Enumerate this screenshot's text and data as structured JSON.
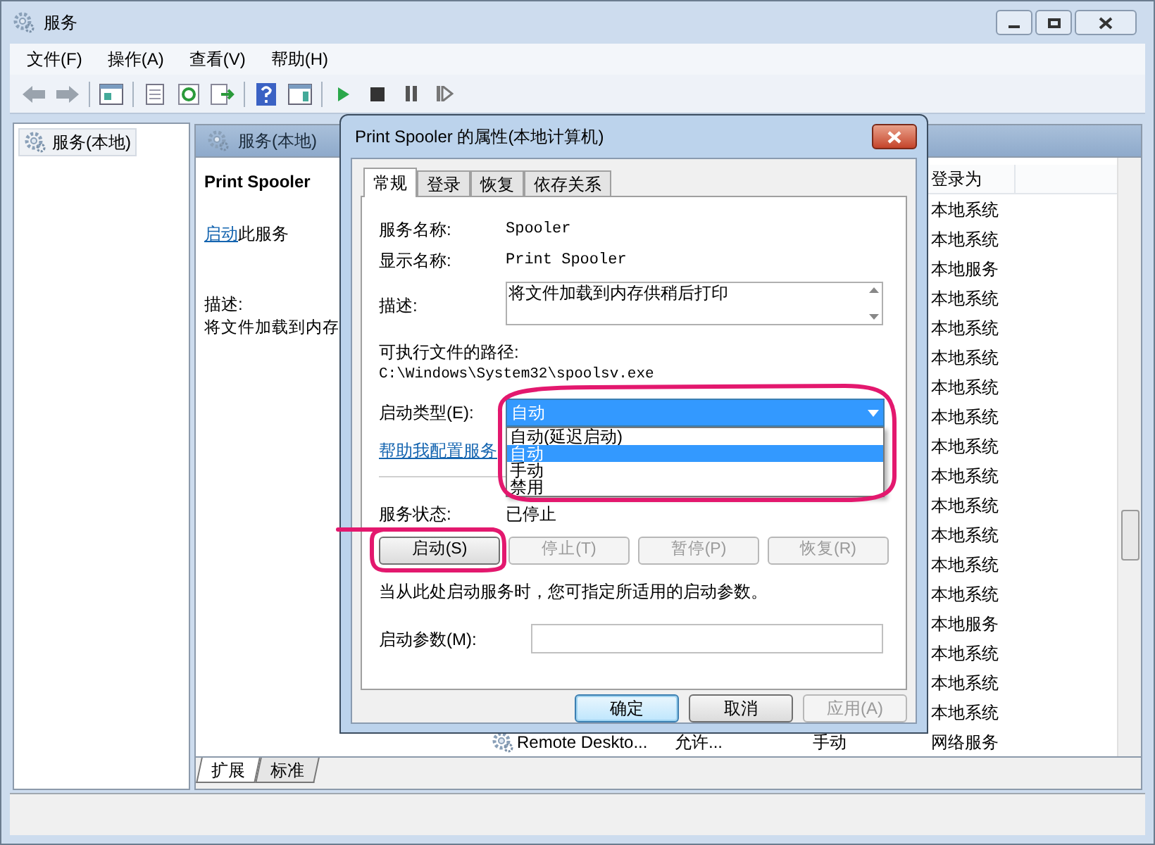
{
  "window": {
    "title": "服务",
    "menu": [
      "文件(F)",
      "操作(A)",
      "查看(V)",
      "帮助(H)"
    ]
  },
  "tree": {
    "items": [
      {
        "label": "服务(本地)",
        "selected": true
      }
    ]
  },
  "pane": {
    "header": "服务(本地)",
    "detail": {
      "service_name": "Print Spooler",
      "action_link": "启动",
      "action_text": "此服务",
      "description_label": "描述:",
      "description": "将文件加载到内存"
    },
    "list": {
      "columns": [
        {
          "label": "登录为"
        }
      ],
      "rows": [
        {
          "logon": "本地系统"
        },
        {
          "logon": "本地系统"
        },
        {
          "logon": "本地服务"
        },
        {
          "logon": "本地系统"
        },
        {
          "logon": "本地系统"
        },
        {
          "logon": "本地系统"
        },
        {
          "logon": "本地系统"
        },
        {
          "logon": "本地系统"
        },
        {
          "logon": "本地系统"
        },
        {
          "logon": "本地系统"
        },
        {
          "logon": "本地系统"
        },
        {
          "logon": "本地系统"
        },
        {
          "logon": "本地系统"
        },
        {
          "logon": "本地系统"
        },
        {
          "logon": "本地服务"
        },
        {
          "logon": "本地系统"
        },
        {
          "logon": "本地系统"
        },
        {
          "logon": "本地系统"
        },
        {
          "name": "Remote Deskto...",
          "description": "允许...",
          "startup": "手动",
          "logon": "网络服务"
        }
      ]
    },
    "bottom_tabs": [
      {
        "label": "扩展",
        "selected": true
      },
      {
        "label": "标准",
        "selected": false
      }
    ]
  },
  "dialog": {
    "title": "Print Spooler 的属性(本地计算机)",
    "tabs": [
      {
        "label": "常规",
        "selected": true
      },
      {
        "label": "登录",
        "selected": false
      },
      {
        "label": "恢复",
        "selected": false
      },
      {
        "label": "依存关系",
        "selected": false
      }
    ],
    "fields": [
      {
        "label": "服务名称:",
        "value": "Spooler"
      },
      {
        "label": "显示名称:",
        "value": "Print Spooler"
      }
    ],
    "description": {
      "label": "描述:",
      "value": "将文件加载到内存供稍后打印"
    },
    "path": {
      "label": "可执行文件的路径:",
      "value": "C:\\Windows\\System32\\spoolsv.exe"
    },
    "startup_type": {
      "label": "启动类型(E):",
      "value": "自动",
      "expanded": true,
      "options": [
        {
          "label": "自动(延迟启动)",
          "selected": false
        },
        {
          "label": "自动",
          "selected": true
        },
        {
          "label": "手动",
          "selected": false
        },
        {
          "label": "禁用",
          "selected": false
        }
      ]
    },
    "help_link": "帮助我配置服务",
    "status": {
      "label": "服务状态:",
      "value": "已停止"
    },
    "service_buttons": [
      {
        "label": "启动(S)",
        "disabled": false
      },
      {
        "label": "停止(T)",
        "disabled": true
      },
      {
        "label": "暂停(P)",
        "disabled": true
      },
      {
        "label": "恢复(R)",
        "disabled": true
      }
    ],
    "hint": "当从此处启动服务时，您可指定所适用的启动参数。",
    "params": {
      "label": "启动参数(M):"
    },
    "buttons": [
      {
        "label": "确定",
        "default": true,
        "disabled": false
      },
      {
        "label": "取消",
        "default": false,
        "disabled": false
      },
      {
        "label": "应用(A)",
        "default": false,
        "disabled": true
      }
    ]
  }
}
